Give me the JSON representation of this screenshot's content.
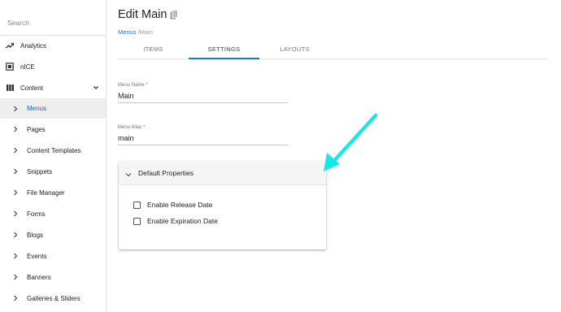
{
  "sidebar": {
    "search_placeholder": "Search",
    "items": [
      {
        "label": "Analytics",
        "icon": "trending-up-icon"
      },
      {
        "label": "nICE",
        "icon": "nice-icon"
      },
      {
        "label": "Content",
        "icon": "view-list-icon",
        "expanded": true
      }
    ],
    "sub_items": [
      {
        "label": "Menus",
        "active": true
      },
      {
        "label": "Pages"
      },
      {
        "label": "Content Templates"
      },
      {
        "label": "Snippets"
      },
      {
        "label": "File Manager"
      },
      {
        "label": "Forms"
      },
      {
        "label": "Blogs"
      },
      {
        "label": "Events"
      },
      {
        "label": "Banners"
      },
      {
        "label": "Galleries & Sliders"
      }
    ]
  },
  "header": {
    "title": "Edit Main",
    "breadcrumb": {
      "link": "Menus",
      "separator": " /",
      "current": "Main"
    }
  },
  "tabs": [
    {
      "label": "ITEMS"
    },
    {
      "label": "SETTINGS",
      "active": true
    },
    {
      "label": "LAYOUTS"
    }
  ],
  "form": {
    "menu_name": {
      "label": "Menu Name *",
      "value": "Main"
    },
    "menu_alias": {
      "label": "Menu Alias *",
      "value": "main"
    }
  },
  "panel": {
    "title": "Default Properties",
    "expanded": true,
    "checkboxes": [
      {
        "label": "Enable Release Date",
        "checked": false
      },
      {
        "label": "Enable Expiration Date",
        "checked": false
      }
    ]
  },
  "colors": {
    "accent": "#1976d2",
    "annotation_arrow": "#19e6e6"
  }
}
